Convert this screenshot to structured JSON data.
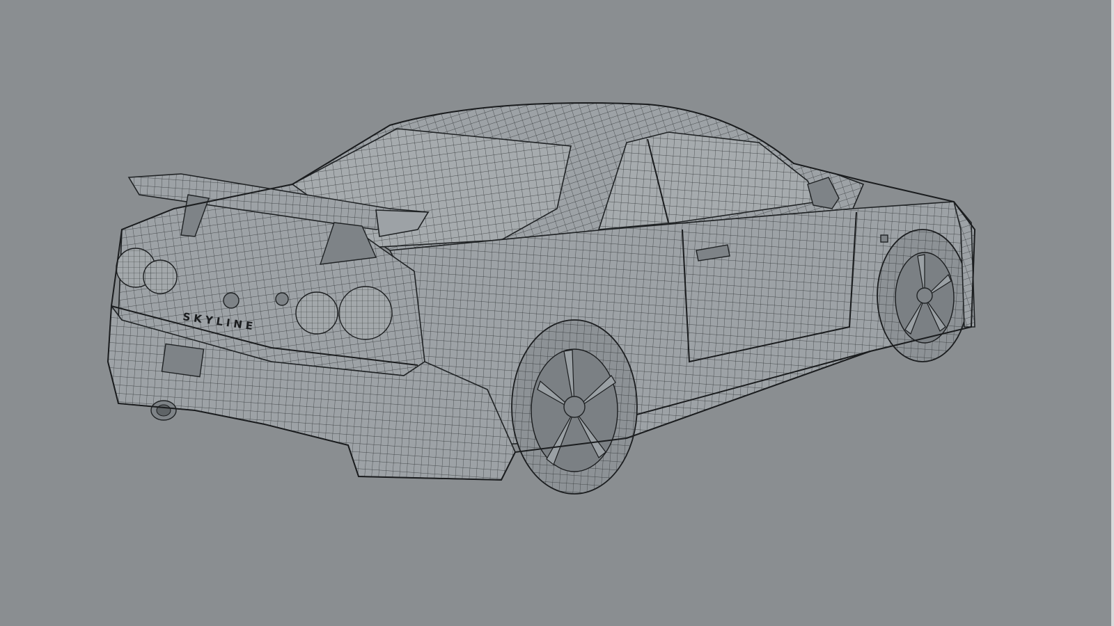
{
  "scene": {
    "background_color": "#8a8e91",
    "model_fill": "#9da2a6",
    "wire_color": "#1f2224",
    "badge_text": "SKYLINE"
  }
}
